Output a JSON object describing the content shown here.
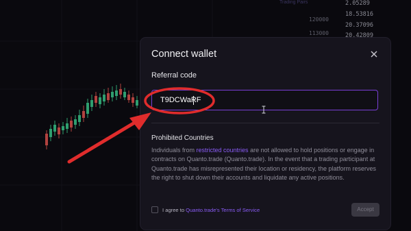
{
  "dialog": {
    "title": "Connect wallet",
    "close_icon": "close-icon",
    "referral_label": "Referral code",
    "referral_value": "T9DCWaRF",
    "prohibited_title": "Prohibited Countries",
    "notice_part1": "Individuals from ",
    "notice_link": "restricted countries",
    "notice_part2": " are not allowed to hold positions or engage in contracts on Quanto.trade (Quanto.trade). In the event that a trading participant at Quanto.trade has misrepresented their location or residency, the platform reserves the right to shut down their accounts and liquidate any active positions.",
    "agree_prefix": "I agree to",
    "agree_link": "Quanto.trade's Terms of Service",
    "accept_label": "Accept"
  },
  "background": {
    "price_ticks": [
      "2.05289",
      "18.53816",
      "20.37096",
      "20.42809"
    ],
    "mid_labels": [
      "120000",
      "113000"
    ],
    "top_faint": "Trading Pairs"
  },
  "annotations": {
    "arrow_color": "#e02c2c",
    "circle_color": "#e02c2c"
  },
  "colors": {
    "accent": "#8a5cf6",
    "input_border": "#7a3fd6",
    "dialog_bg": "#16141d"
  }
}
